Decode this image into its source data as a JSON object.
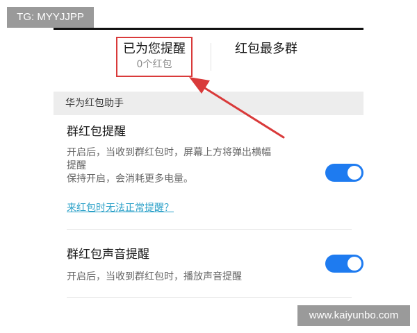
{
  "watermark": {
    "top": "TG: MYYJJPP",
    "bottom": "www.kaiyunbo.com"
  },
  "tabs": {
    "reminded": {
      "title": "已为您提醒",
      "count": "0个红包"
    },
    "most_groups": {
      "title": "红包最多群"
    }
  },
  "section": {
    "title": "华为红包助手"
  },
  "settings": [
    {
      "title": "群红包提醒",
      "desc_line1": "开启后，当收到群红包时，屏幕上方将弹出横幅",
      "desc_line2": "提醒",
      "desc_line3": "保持开启，会消耗更多电量。",
      "link": "来红包时无法正常提醒？",
      "enabled": true
    },
    {
      "title": "群红包声音提醒",
      "desc_line1": "开启后，当收到群红包时，播放声音提醒",
      "enabled": true
    }
  ],
  "colors": {
    "toggle_on": "#1e7bf0",
    "highlight": "#d93a3a",
    "link": "#2aa0c8"
  }
}
